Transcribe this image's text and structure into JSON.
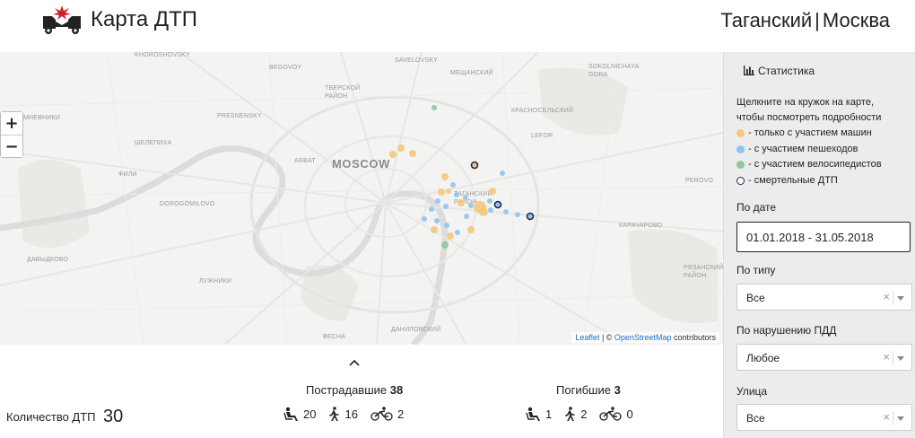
{
  "header": {
    "title": "Карта ДТП",
    "district": "Таганский",
    "separator": "|",
    "city": "Москва"
  },
  "map": {
    "zoom_in": "+",
    "zoom_out": "−",
    "attribution": {
      "leaflet": "Leaflet",
      "sep": " | © ",
      "osm": "OpenStreetMap",
      "contrib": " contributors"
    },
    "labels": {
      "moscow": "MOSCOW",
      "khoroshovsky": "KHOROSHOVSKY",
      "begovoy": "BEGOVOY",
      "savelovsky": "SAVELOVSKY",
      "meshchansky": "МЕЩАНСКИЙ",
      "tverskoy": "ТВЕРСКОЙ РАЙОН",
      "presnensky": "PRESNENSKY",
      "krasnoselsky": "КРАСНОСЕЛЬСКИЙ",
      "sokolniki": "SOKOLNICHAYA GORA",
      "shelepikha": "ШЕЛЕПИХА",
      "arbat": "ARBAT",
      "fili": "ФИЛИ",
      "lefort": "LEFOR",
      "taganskiy": "ТАГАНСКИЙ РАЙОН",
      "dorogomilovo": "DOROGOMILOVO",
      "karacharovo": "КАРАЧАРОВО",
      "davydkovo": "ДАВЫДКОВО",
      "luzhniki": "ЛУЖНИКИ",
      "danilovsky": "ДАНИЛОВСКИЙ",
      "ryazansky": "РЯЗАНСКИЙ РАЙОН",
      "mnevniki": "МНЕВНИКИ",
      "vesna": "ВЕСНА",
      "perovo": "PEROVO"
    }
  },
  "sidebar": {
    "tab_label": "Статистика",
    "hint_line1": "Щелкните на кружок на карте,",
    "hint_line2": "чтобы посмотреть подробности",
    "legend": [
      {
        "label": "- только с участием машин",
        "color": "#f5c77e"
      },
      {
        "label": "- с участием пешеходов",
        "color": "#8ec5f0"
      },
      {
        "label": "- с участием велосипедистов",
        "color": "#8fc99a"
      },
      {
        "label": "- смертельные ДТП",
        "color": "#1a2a4a"
      }
    ],
    "date_label": "По дате",
    "date_value": "01.01.2018 - 31.05.2018",
    "type_label": "По типу",
    "type_value": "Все",
    "violation_label": "По нарушению ПДД",
    "violation_value": "Любое",
    "street_label": "Улица",
    "street_value": "Все",
    "clear_symbol": "×"
  },
  "stats": {
    "count_label": "Количество ДТП",
    "count_value": "30",
    "injured_label": "Пострадавшие",
    "injured_total": "38",
    "injured": {
      "drivers": "20",
      "pedestrians": "16",
      "cyclists": "2"
    },
    "killed_label": "Погибшие",
    "killed_total": "3",
    "killed": {
      "drivers": "1",
      "pedestrians": "2",
      "cyclists": "0"
    }
  },
  "colors": {
    "cars": "#f5c77e",
    "pedestrians": "#8ec5f0",
    "cyclists": "#8fc99a",
    "fatal": "#1a2a4a",
    "logo_red": "#d0202a"
  }
}
